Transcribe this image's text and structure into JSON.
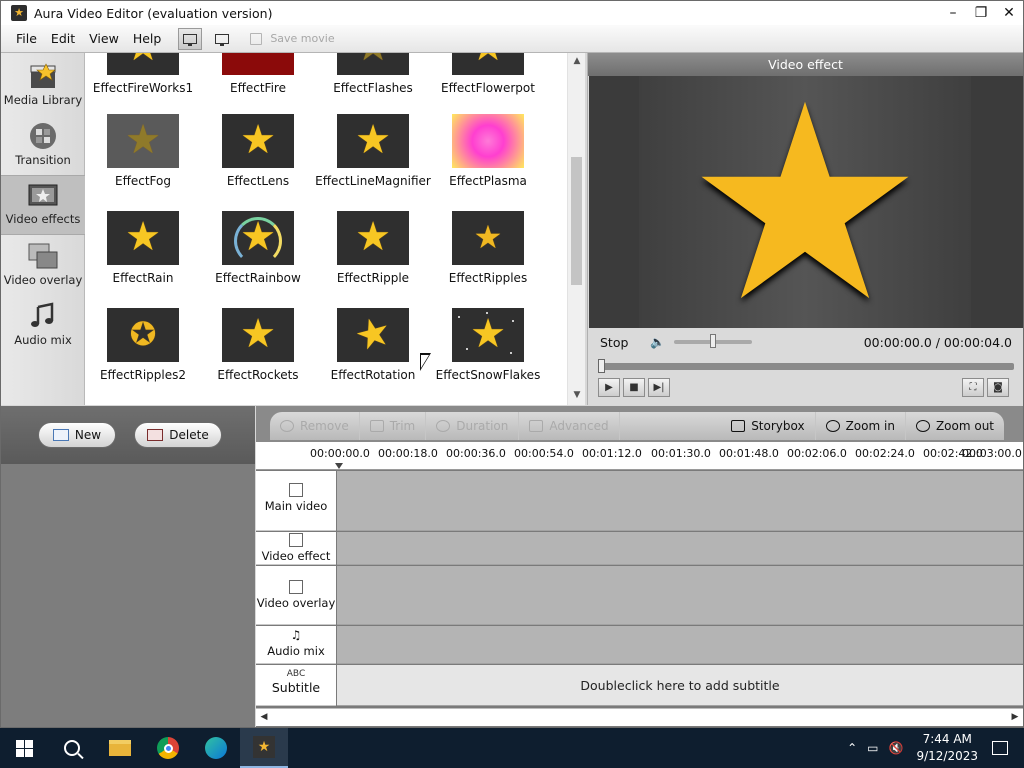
{
  "window": {
    "title": "Aura Video Editor (evaluation version)",
    "controls": [
      "minimize-icon",
      "restore-icon",
      "close-icon"
    ]
  },
  "menu": {
    "items": [
      "File",
      "Edit",
      "View",
      "Help"
    ],
    "save_movie": "Save movie"
  },
  "sidebar": {
    "items": [
      {
        "label": "Media Library",
        "icon": "film-clapper-icon"
      },
      {
        "label": "Transition",
        "icon": "transition-icon"
      },
      {
        "label": "Video effects",
        "icon": "video-effects-icon",
        "active": true
      },
      {
        "label": "Video overlay",
        "icon": "video-overlay-icon"
      },
      {
        "label": "Audio mix",
        "icon": "music-note-icon"
      }
    ]
  },
  "effects": {
    "items": [
      {
        "label": "EffectFireWorks1"
      },
      {
        "label": "EffectFire"
      },
      {
        "label": "EffectFlashes"
      },
      {
        "label": "EffectFlowerpot"
      },
      {
        "label": "EffectFog"
      },
      {
        "label": "EffectLens"
      },
      {
        "label": "EffectLineMagnifier"
      },
      {
        "label": "EffectPlasma"
      },
      {
        "label": "EffectRain"
      },
      {
        "label": "EffectRainbow"
      },
      {
        "label": "EffectRipple"
      },
      {
        "label": "EffectRipples"
      },
      {
        "label": "EffectRipples2"
      },
      {
        "label": "EffectRockets"
      },
      {
        "label": "EffectRotation"
      },
      {
        "label": "EffectSnowFlakes"
      }
    ]
  },
  "preview": {
    "title": "Video effect",
    "state_label": "Stop",
    "time": "00:00:00.0 / 00:00:04.0",
    "volume_fraction": 0.5,
    "seek_fraction": 0.0
  },
  "library_actions": {
    "new_label": "New",
    "delete_label": "Delete"
  },
  "timeline": {
    "toolbar": {
      "remove": "Remove",
      "trim": "Trim",
      "duration": "Duration",
      "advanced": "Advanced",
      "storybox": "Storybox",
      "zoom_in": "Zoom in",
      "zoom_out": "Zoom out"
    },
    "ruler": [
      "00:00:00.0",
      "00:00:18.0",
      "00:00:36.0",
      "00:00:54.0",
      "00:01:12.0",
      "00:01:30.0",
      "00:01:48.0",
      "00:02:06.0",
      "00:02:24.0",
      "00:02:42.0",
      "00:03:00.0"
    ],
    "tracks": [
      {
        "label": "Main video"
      },
      {
        "label": "Video effect"
      },
      {
        "label": "Video overlay"
      },
      {
        "label": "Audio mix"
      },
      {
        "label": "Subtitle",
        "prefix": "ABC"
      }
    ],
    "subtitle_hint": "Doubleclick here to add subtitle"
  },
  "taskbar": {
    "clock_time": "7:44 AM",
    "clock_date": "9/12/2023"
  }
}
